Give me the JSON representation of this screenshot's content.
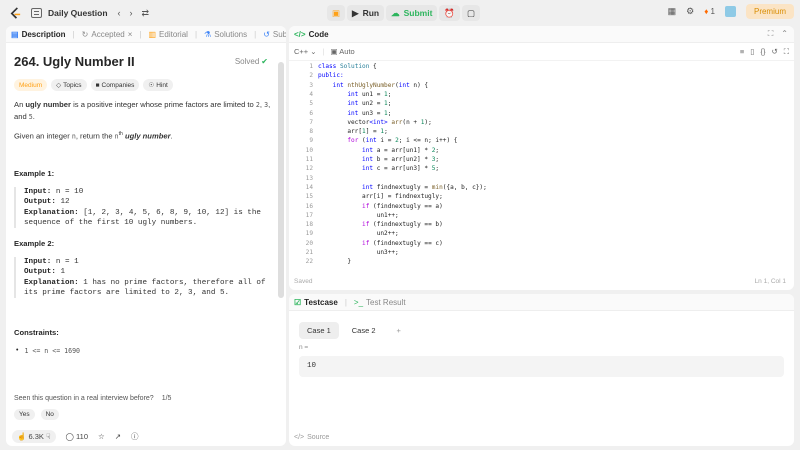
{
  "topbar": {
    "title": "Daily Question",
    "run_label": "Run",
    "submit_label": "Submit",
    "streak_count": "1",
    "premium_label": "Premium",
    "accent": "#ffa116"
  },
  "left_tabs": [
    {
      "label": "Description"
    },
    {
      "label": "Accepted"
    },
    {
      "label": "Editorial"
    },
    {
      "label": "Solutions"
    },
    {
      "label": "Submissions"
    }
  ],
  "problem": {
    "title": "264. Ugly Number II",
    "solved_label": "Solved",
    "difficulty": "Medium",
    "chips": [
      "Topics",
      "Companies",
      "Hint"
    ],
    "desc_1a": "An ",
    "desc_1b": "ugly number",
    "desc_1c": " is a positive integer whose prime factors are limited to ",
    "code2": "2",
    "code3": "3",
    "code5": "5",
    "comma": ", ",
    "and": ", and ",
    "period": ".",
    "desc_2a": "Given an integer ",
    "n": "n",
    "desc_2b": ", return the ",
    "nth": "n",
    "th": "th",
    "ugly": "ugly number",
    "examples": [
      {
        "heading": "Example 1:",
        "input_label": "Input:",
        "input": "n = 10",
        "output_label": "Output:",
        "output": "12",
        "expl_label": "Explanation:",
        "expl": "[1, 2, 3, 4, 5, 6, 8, 9, 10, 12] is the sequence of the first 10 ugly numbers."
      },
      {
        "heading": "Example 2:",
        "input_label": "Input:",
        "input": "n = 1",
        "output_label": "Output:",
        "output": "1",
        "expl_label": "Explanation:",
        "expl": "1 has no prime factors, therefore all of its prime factors are limited to 2, 3, and 5."
      }
    ],
    "constraints_heading": "Constraints:",
    "constraint": "1 <= n <= 1690",
    "interview_q": "Seen this question in a real interview before?",
    "interview_pages": "1/5",
    "yes": "Yes",
    "no": "No",
    "likes": "6.3K",
    "comments": "110"
  },
  "code": {
    "tab_label": "Code",
    "language": "C++",
    "auto_label": "Auto",
    "saved_label": "Saved",
    "cursor_pos": "Ln 1, Col 1",
    "lines": [
      [
        {
          "t": "class ",
          "c": "kw"
        },
        {
          "t": "Solution",
          "c": "ty"
        },
        {
          "t": " {",
          "c": ""
        }
      ],
      [
        {
          "t": "public:",
          "c": "kw"
        }
      ],
      [
        {
          "t": "    int ",
          "c": "kw"
        },
        {
          "t": "nthUglyNumber",
          "c": "fn"
        },
        {
          "t": "(",
          "c": ""
        },
        {
          "t": "int",
          "c": "kw"
        },
        {
          "t": " n) {",
          "c": ""
        }
      ],
      [
        {
          "t": "        int ",
          "c": "kw"
        },
        {
          "t": "un1 = ",
          "c": ""
        },
        {
          "t": "1",
          "c": "num"
        },
        {
          "t": ";",
          "c": ""
        }
      ],
      [
        {
          "t": "        int ",
          "c": "kw"
        },
        {
          "t": "un2 = ",
          "c": ""
        },
        {
          "t": "1",
          "c": "num"
        },
        {
          "t": ";",
          "c": ""
        }
      ],
      [
        {
          "t": "        int ",
          "c": "kw"
        },
        {
          "t": "un3 = ",
          "c": ""
        },
        {
          "t": "1",
          "c": "num"
        },
        {
          "t": ";",
          "c": ""
        }
      ],
      [
        {
          "t": "        vector",
          "c": ""
        },
        {
          "t": "<int>",
          "c": "kw"
        },
        {
          "t": " arr",
          "c": "fn"
        },
        {
          "t": "(n + ",
          "c": ""
        },
        {
          "t": "1",
          "c": "num"
        },
        {
          "t": ");",
          "c": ""
        }
      ],
      [
        {
          "t": "        arr[",
          "c": ""
        },
        {
          "t": "1",
          "c": "num"
        },
        {
          "t": "] = ",
          "c": ""
        },
        {
          "t": "1",
          "c": "num"
        },
        {
          "t": ";",
          "c": ""
        }
      ],
      [
        {
          "t": "        ",
          "c": ""
        },
        {
          "t": "for",
          "c": "ctl"
        },
        {
          "t": " (",
          "c": ""
        },
        {
          "t": "int",
          "c": "kw"
        },
        {
          "t": " i = ",
          "c": ""
        },
        {
          "t": "2",
          "c": "num"
        },
        {
          "t": "; i <= n; i++) {",
          "c": ""
        }
      ],
      [
        {
          "t": "            int ",
          "c": "kw"
        },
        {
          "t": "a = arr[un1] * ",
          "c": ""
        },
        {
          "t": "2",
          "c": "num"
        },
        {
          "t": ";",
          "c": ""
        }
      ],
      [
        {
          "t": "            int ",
          "c": "kw"
        },
        {
          "t": "b = arr[un2] * ",
          "c": ""
        },
        {
          "t": "3",
          "c": "num"
        },
        {
          "t": ";",
          "c": ""
        }
      ],
      [
        {
          "t": "            int ",
          "c": "kw"
        },
        {
          "t": "c = arr[un3] * ",
          "c": ""
        },
        {
          "t": "5",
          "c": "num"
        },
        {
          "t": ";",
          "c": ""
        }
      ],
      [
        {
          "t": "",
          "c": ""
        }
      ],
      [
        {
          "t": "            int ",
          "c": "kw"
        },
        {
          "t": "findnextugly = ",
          "c": ""
        },
        {
          "t": "min",
          "c": "fn"
        },
        {
          "t": "({a, b, c});",
          "c": ""
        }
      ],
      [
        {
          "t": "            arr[i] = findnextugly;",
          "c": ""
        }
      ],
      [
        {
          "t": "            ",
          "c": ""
        },
        {
          "t": "if",
          "c": "ctl"
        },
        {
          "t": " (findnextugly == a)",
          "c": ""
        }
      ],
      [
        {
          "t": "                un1++;",
          "c": ""
        }
      ],
      [
        {
          "t": "            ",
          "c": ""
        },
        {
          "t": "if",
          "c": "ctl"
        },
        {
          "t": " (findnextugly == b)",
          "c": ""
        }
      ],
      [
        {
          "t": "                un2++;",
          "c": ""
        }
      ],
      [
        {
          "t": "            ",
          "c": ""
        },
        {
          "t": "if",
          "c": "ctl"
        },
        {
          "t": " (findnextugly == c)",
          "c": ""
        }
      ],
      [
        {
          "t": "                un3++;",
          "c": ""
        }
      ],
      [
        {
          "t": "        }",
          "c": ""
        }
      ]
    ]
  },
  "testcase": {
    "tab_label": "Testcase",
    "result_label": "Test Result",
    "cases": [
      "Case 1",
      "Case 2"
    ],
    "add_label": "+",
    "input_label": "n =",
    "input_value": "10",
    "source_label": "Source"
  }
}
